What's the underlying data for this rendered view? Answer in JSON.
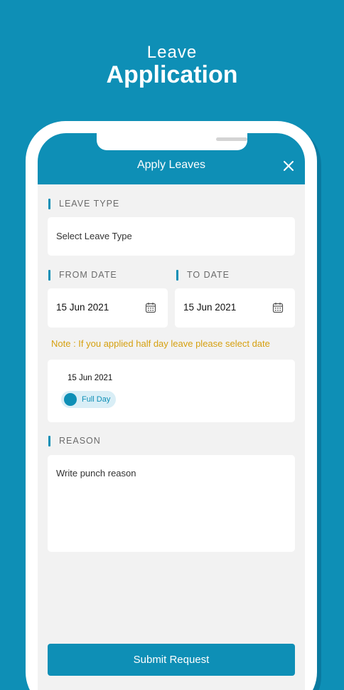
{
  "hero": {
    "line1": "Leave",
    "line2": "Application"
  },
  "appbar": {
    "title": "Apply Leaves",
    "close_icon": "close-icon"
  },
  "leave_type": {
    "label": "LEAVE TYPE",
    "placeholder": "Select Leave Type"
  },
  "from_date": {
    "label": "FROM DATE",
    "value": "15 Jun 2021",
    "icon": "calendar-icon"
  },
  "to_date": {
    "label": "TO DATE",
    "value": "15 Jun 2021",
    "icon": "calendar-icon"
  },
  "note": "Note : If you applied half day leave please select date",
  "day_selection": {
    "date": "15 Jun 2021",
    "option": "Full Day"
  },
  "reason": {
    "label": "REASON",
    "placeholder": "Write punch reason"
  },
  "submit_label": "Submit Request",
  "colors": {
    "primary": "#0e8fb6",
    "note": "#d6a010",
    "background": "#f2f2f2"
  }
}
